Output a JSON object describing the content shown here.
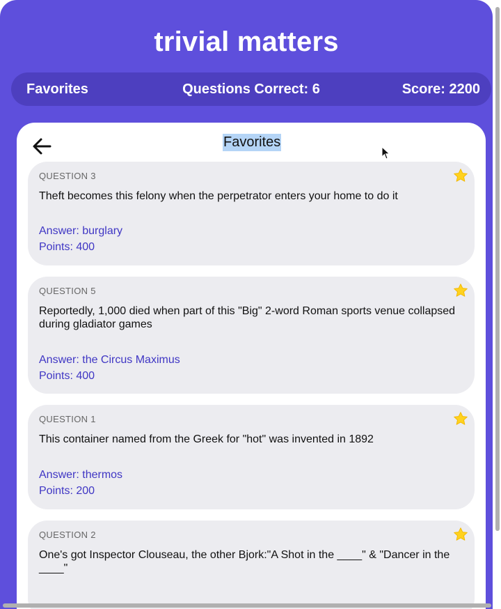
{
  "app": {
    "title": "trivial matters"
  },
  "stats": {
    "section": "Favorites",
    "questions_correct": "Questions Correct: 6",
    "score": "Score: 2200"
  },
  "panel": {
    "title": "Favorites"
  },
  "cards": [
    {
      "label": "QUESTION 3",
      "question": "Theft becomes this felony when the perpetrator enters your home to do it",
      "answer": "Answer: burglary",
      "points": "Points: 400"
    },
    {
      "label": "QUESTION 5",
      "question": "Reportedly, 1,000 died when part of this \"Big\" 2-word Roman sports venue collapsed during gladiator games",
      "answer": "Answer: the Circus Maximus",
      "points": "Points: 400"
    },
    {
      "label": "QUESTION 1",
      "question": "This container named from the Greek for \"hot\" was invented in 1892",
      "answer": "Answer: thermos",
      "points": "Points: 200"
    },
    {
      "label": "QUESTION 2",
      "question": "One's got Inspector Clouseau, the other Bjork:\"A Shot in the ____\" & \"Dancer in the ____\""
    }
  ],
  "icons": {
    "back": "arrow-left-icon",
    "favorite": "star-icon",
    "pointer": "mouse-cursor"
  },
  "colors": {
    "background": "#5e4fdc",
    "stats_bar": "#4d3fbf",
    "card": "#ececf0",
    "answer_text": "#3f36c4",
    "star": "#ffd21f"
  }
}
